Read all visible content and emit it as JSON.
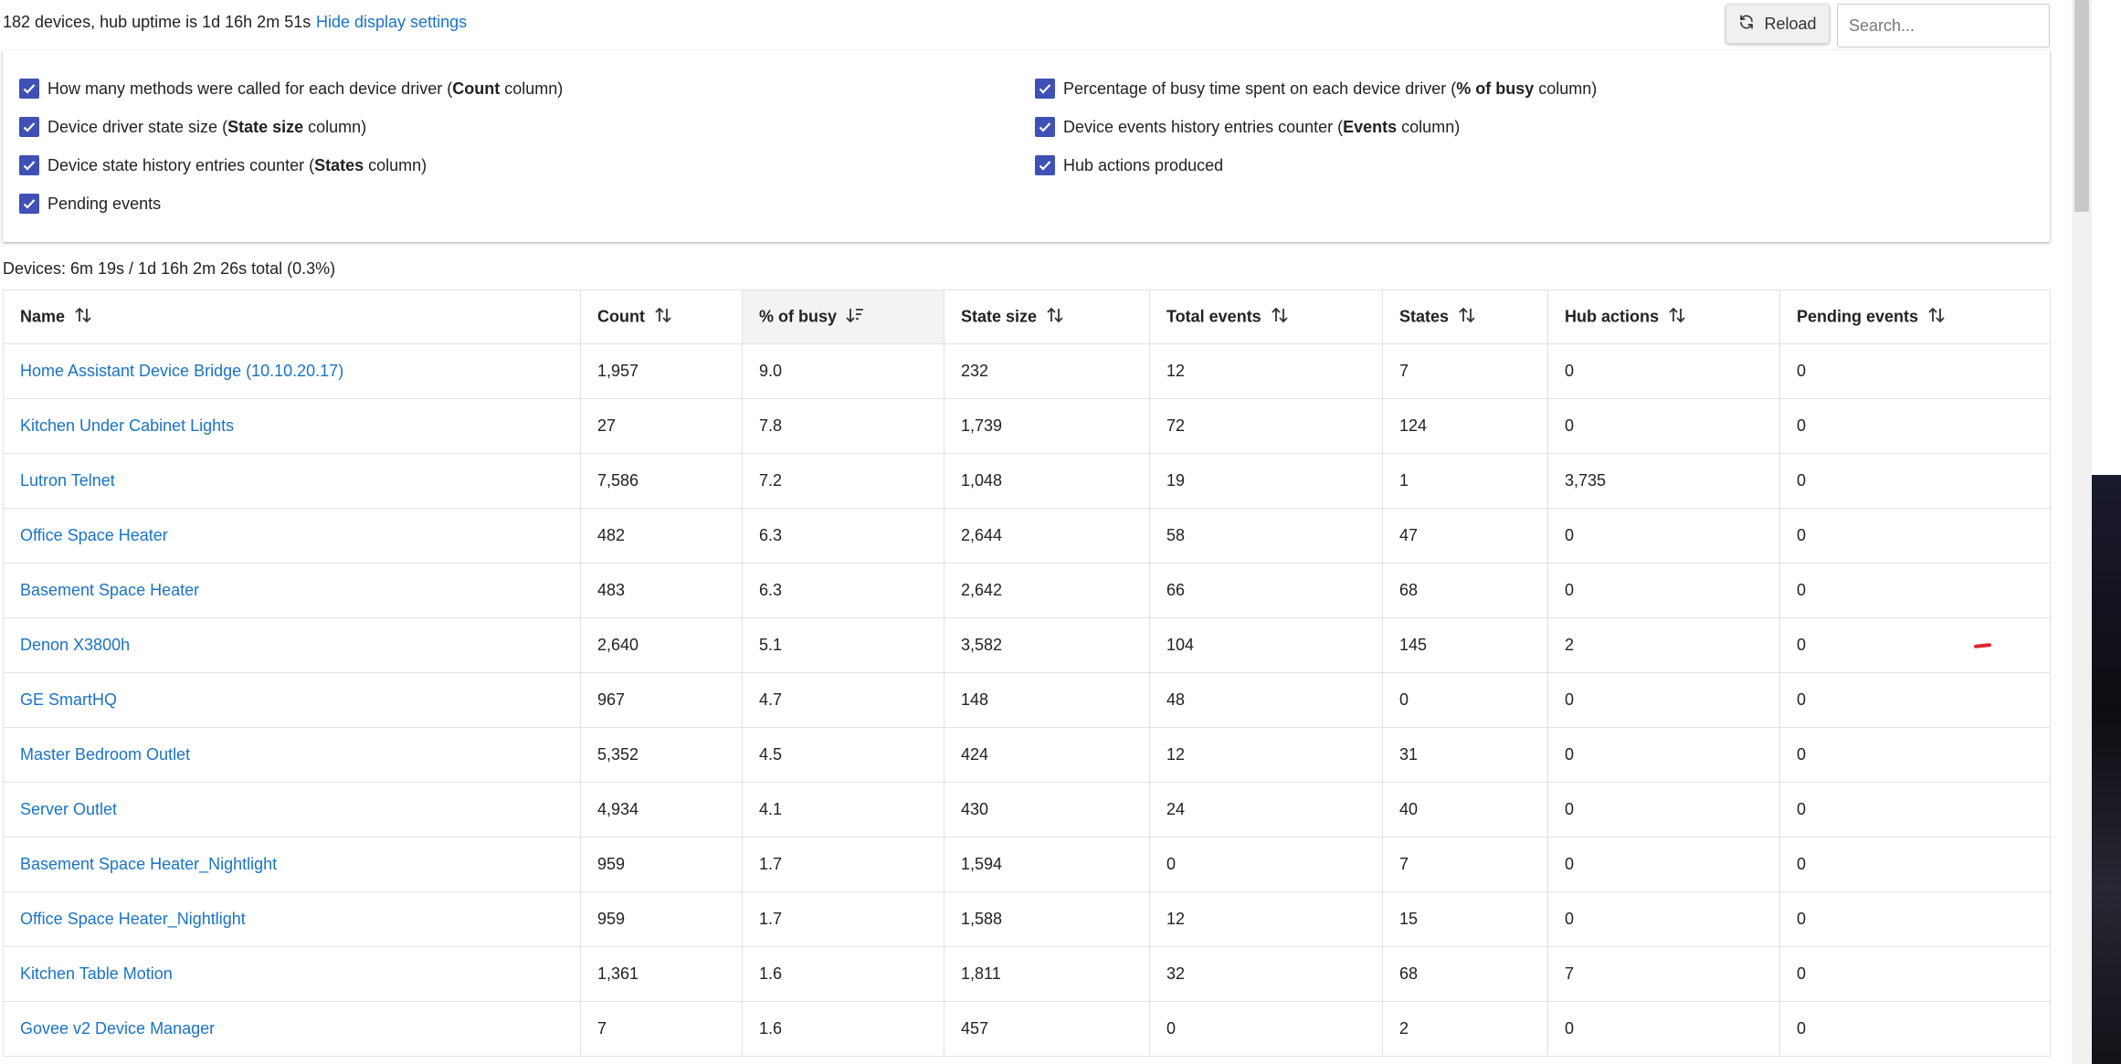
{
  "top_bar": {
    "summary": "182 devices, hub uptime is 1d 16h 2m 51s",
    "hide_link": "Hide display settings",
    "reload_label": "Reload",
    "search_placeholder": "Search..."
  },
  "settings": {
    "options": [
      {
        "pre": "How many methods were called for each device driver (",
        "bold": "Count",
        "post": " column)",
        "checked": true
      },
      {
        "pre": "Device driver state size (",
        "bold": "State size",
        "post": " column)",
        "checked": true
      },
      {
        "pre": "Device state history entries counter (",
        "bold": "States",
        "post": " column)",
        "checked": true
      },
      {
        "pre": "Pending events",
        "bold": "",
        "post": "",
        "checked": true
      },
      {
        "pre": "Percentage of busy time spent on each device driver (",
        "bold": "% of busy",
        "post": " column)",
        "checked": true
      },
      {
        "pre": "Device events history entries counter (",
        "bold": "Events",
        "post": " column)",
        "checked": true
      },
      {
        "pre": "Hub actions produced",
        "bold": "",
        "post": "",
        "checked": true
      }
    ]
  },
  "devices_summary": "Devices: 6m 19s / 1d 16h 2m 26s total (0.3%)",
  "table": {
    "columns": [
      "Name",
      "Count",
      "% of busy",
      "State size",
      "Total events",
      "States",
      "Hub actions",
      "Pending events"
    ],
    "sorted_column": "% of busy",
    "rows": [
      [
        "Home Assistant Device Bridge (10.10.20.17)",
        "1,957",
        "9.0",
        "232",
        "12",
        "7",
        "0",
        "0"
      ],
      [
        "Kitchen Under Cabinet Lights",
        "27",
        "7.8",
        "1,739",
        "72",
        "124",
        "0",
        "0"
      ],
      [
        "Lutron Telnet",
        "7,586",
        "7.2",
        "1,048",
        "19",
        "1",
        "3,735",
        "0"
      ],
      [
        "Office Space Heater",
        "482",
        "6.3",
        "2,644",
        "58",
        "47",
        "0",
        "0"
      ],
      [
        "Basement Space Heater",
        "483",
        "6.3",
        "2,642",
        "66",
        "68",
        "0",
        "0"
      ],
      [
        "Denon X3800h",
        "2,640",
        "5.1",
        "3,582",
        "104",
        "145",
        "2",
        "0"
      ],
      [
        "GE SmartHQ",
        "967",
        "4.7",
        "148",
        "48",
        "0",
        "0",
        "0"
      ],
      [
        "Master Bedroom Outlet",
        "5,352",
        "4.5",
        "424",
        "12",
        "31",
        "0",
        "0"
      ],
      [
        "Server Outlet",
        "4,934",
        "4.1",
        "430",
        "24",
        "40",
        "0",
        "0"
      ],
      [
        "Basement Space Heater_Nightlight",
        "959",
        "1.7",
        "1,594",
        "0",
        "7",
        "0",
        "0"
      ],
      [
        "Office Space Heater_Nightlight",
        "959",
        "1.7",
        "1,588",
        "12",
        "15",
        "0",
        "0"
      ],
      [
        "Kitchen Table Motion",
        "1,361",
        "1.6",
        "1,811",
        "32",
        "68",
        "7",
        "0"
      ],
      [
        "Govee v2 Device Manager",
        "7",
        "1.6",
        "457",
        "0",
        "2",
        "0",
        "0"
      ]
    ]
  },
  "colors": {
    "link": "#1a73c6",
    "checkbox": "#3f51b5",
    "annotation_mark": "#e0262a"
  }
}
